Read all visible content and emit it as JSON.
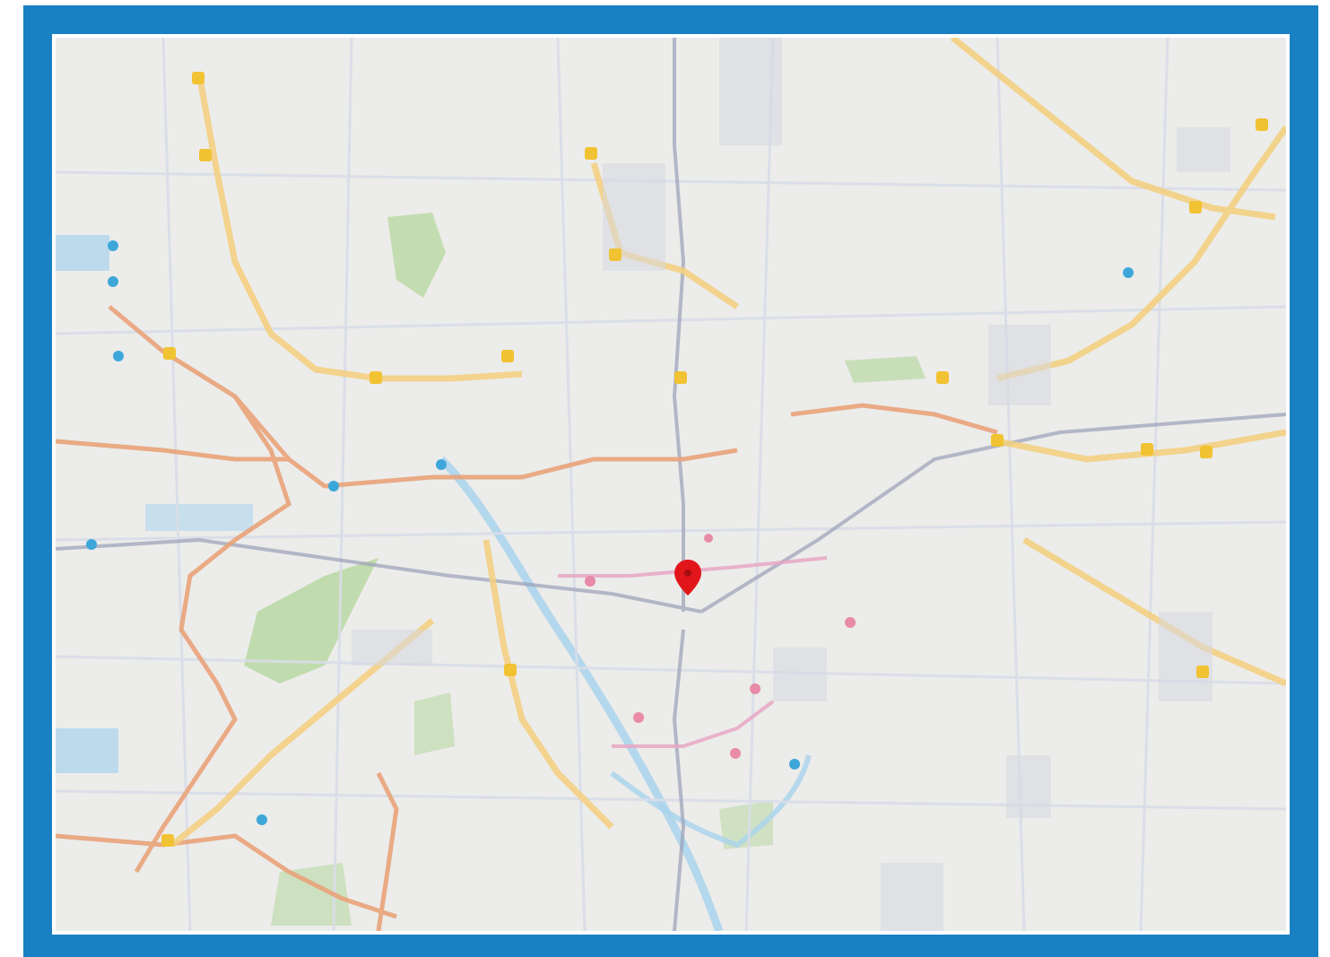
{
  "map": {
    "frame_color": "#1a80c4",
    "land_color": "#ececea",
    "park_color": "#b9d9a3",
    "water_color": "#a9d3ec",
    "major_road_color": "#f4cf7c",
    "arterial_road_color": "#e9a37a",
    "minor_road_color": "#d9dde8",
    "rail_color": "#9aa0b6",
    "location_pin": {
      "icon": "location-pin-icon",
      "color": "#e0161b"
    },
    "marker_icons": {
      "highway_shield": "highway-shield-icon",
      "transit_station": "transit-station-icon",
      "poi": "poi-icon"
    },
    "labels_legible": false
  }
}
